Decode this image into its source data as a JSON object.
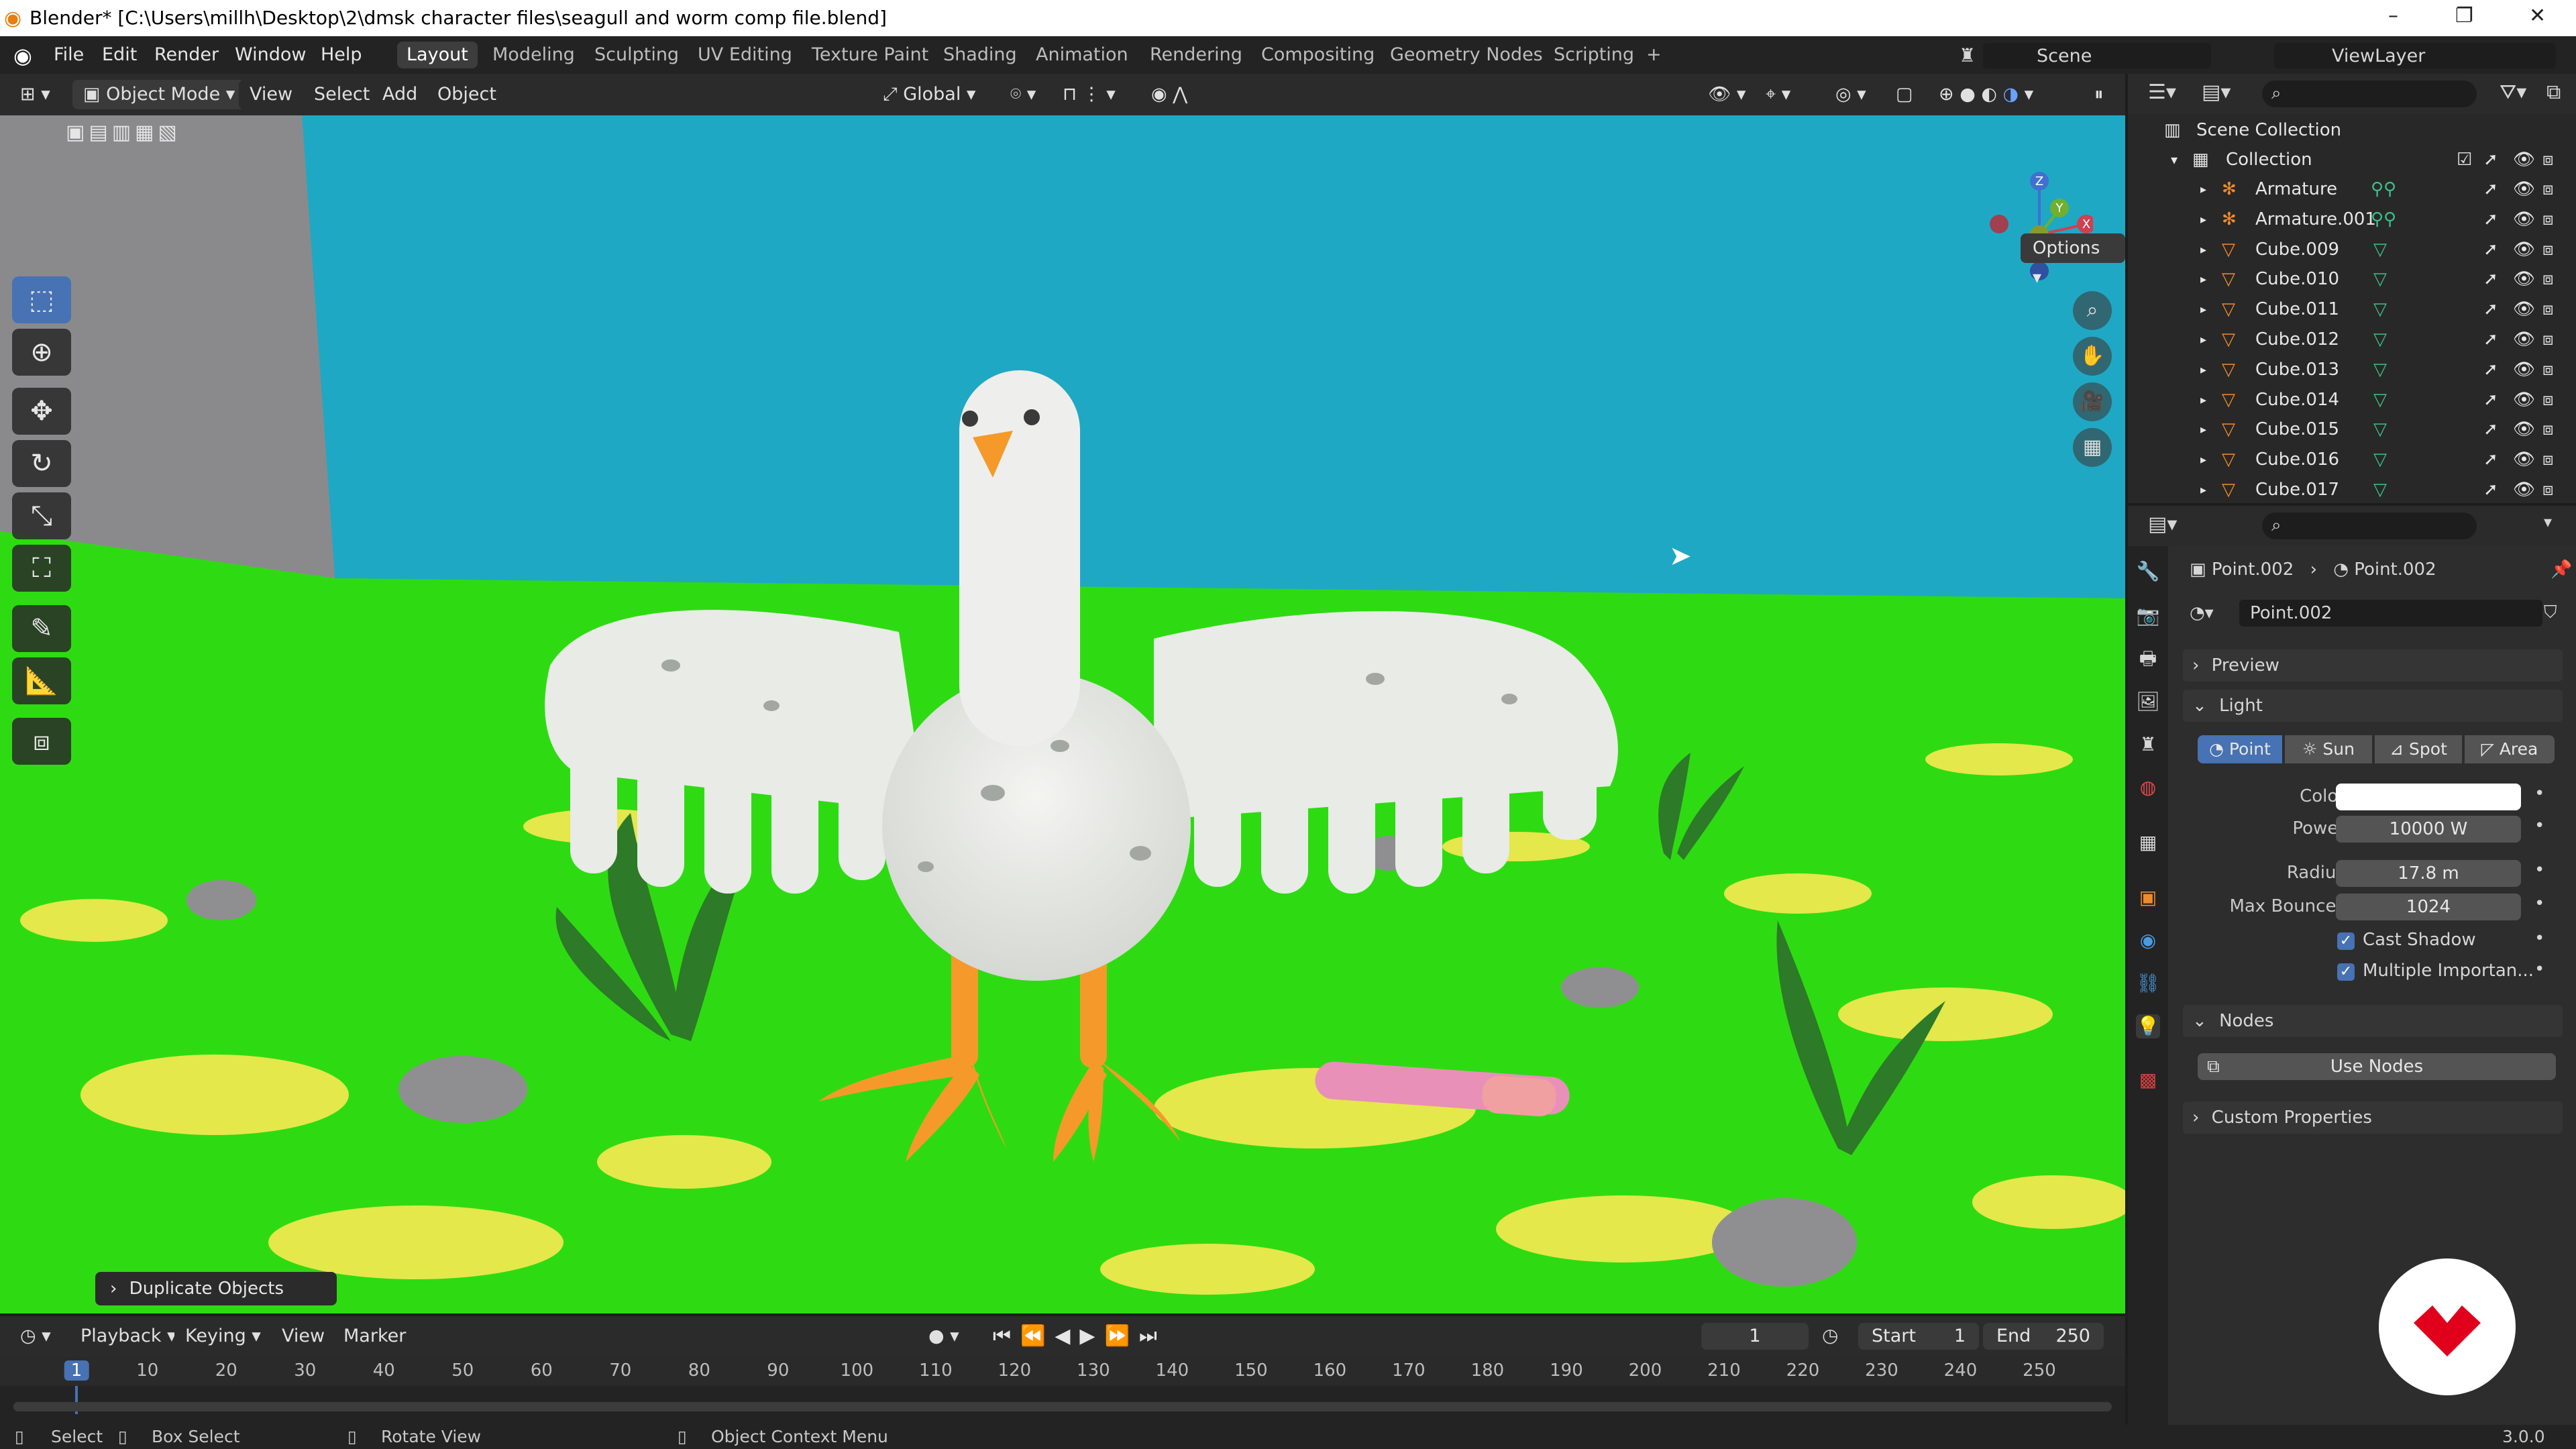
{
  "titlebar": {
    "title": "Blender* [C:\\Users\\millh\\Desktop\\2\\dmsk character files\\seagull and worm comp file.blend]",
    "min": "–",
    "max": "❐",
    "close": "✕"
  },
  "menu": [
    "File",
    "Edit",
    "Render",
    "Window",
    "Help"
  ],
  "workspaces": [
    "Layout",
    "Modeling",
    "Sculpting",
    "UV Editing",
    "Texture Paint",
    "Shading",
    "Animation",
    "Rendering",
    "Compositing",
    "Geometry Nodes",
    "Scripting"
  ],
  "add_workspace": "+",
  "scene": {
    "label": "Scene",
    "view_layer": "ViewLayer"
  },
  "viewport_header": {
    "mode": "Object Mode",
    "view": "View",
    "select": "Select",
    "add": "Add",
    "object": "Object",
    "transform": "Global"
  },
  "viewport": {
    "options": "Options",
    "last_op": "Duplicate Objects"
  },
  "outliner": {
    "scene_collection": "Scene Collection",
    "collection": "Collection",
    "items": [
      "Armature",
      "Armature.001",
      "Cube.009",
      "Cube.010",
      "Cube.011",
      "Cube.012",
      "Cube.013",
      "Cube.014",
      "Cube.015",
      "Cube.016",
      "Cube.017"
    ]
  },
  "properties": {
    "breadcrumb_obj": "Point.002",
    "breadcrumb_data": "Point.002",
    "datablock": "Point.002",
    "preview": "Preview",
    "light": "Light",
    "light_types": [
      "Point",
      "Sun",
      "Spot",
      "Area"
    ],
    "color_label": "Color",
    "power_label": "Power",
    "power": "10000 W",
    "radius_label": "Radius",
    "radius": "17.8 m",
    "bounces_label": "Max Bounces",
    "bounces": "1024",
    "cast_shadow": "Cast Shadow",
    "mis": "Multiple Importan...",
    "nodes": "Nodes",
    "use_nodes": "Use Nodes",
    "custom_props": "Custom Properties"
  },
  "timeline": {
    "playback": "Playback",
    "keying": "Keying",
    "view": "View",
    "marker": "Marker",
    "current_frame": "1",
    "start_label": "Start",
    "start": "1",
    "end_label": "End",
    "end": "250",
    "ticks": [
      "1",
      "10",
      "20",
      "30",
      "40",
      "50",
      "60",
      "70",
      "80",
      "90",
      "100",
      "110",
      "120",
      "130",
      "140",
      "150",
      "160",
      "170",
      "180",
      "190",
      "200",
      "210",
      "220",
      "230",
      "240",
      "250"
    ]
  },
  "statusbar": {
    "select": "Select",
    "box_select": "Box Select",
    "rotate": "Rotate View",
    "context": "Object Context Menu",
    "version": "3.0.0"
  },
  "colors": {
    "accent": "#4772b3",
    "sky": "#1fa8c4",
    "grass": "#2edb12",
    "logo": "#e0001b"
  }
}
